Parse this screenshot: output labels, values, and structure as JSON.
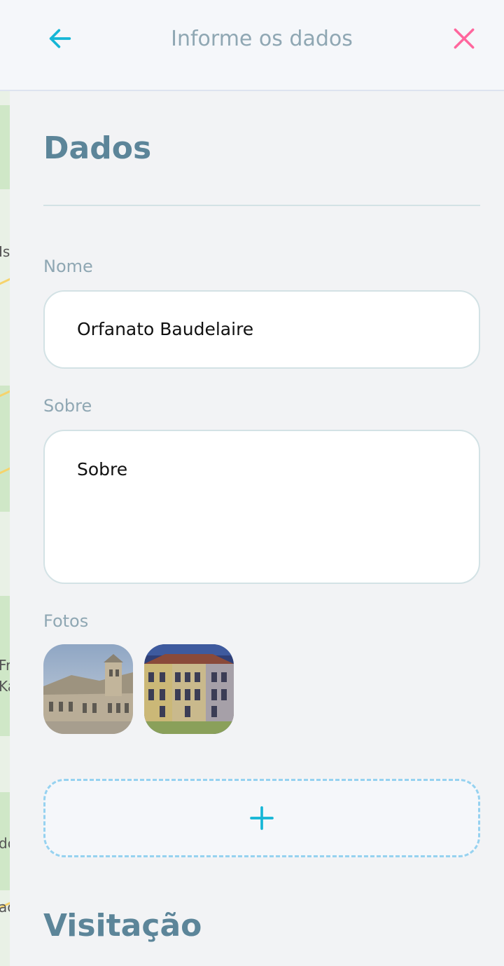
{
  "header": {
    "title": "Informe os dados",
    "back_icon": "arrow-left-icon",
    "close_icon": "close-icon",
    "accent_color": "#15b6d6",
    "close_color": "#ff669d"
  },
  "map_fragments": [
    "Is",
    "Fr",
    "Ka",
    "do",
    "ac"
  ],
  "form": {
    "section_title": "Dados",
    "name_label": "Nome",
    "name_value": "Orfanato Baudelaire",
    "about_label": "Sobre",
    "about_value": "Sobre",
    "photos_label": "Fotos",
    "photos": [
      {
        "icon": "building-photo-1"
      },
      {
        "icon": "building-photo-2"
      }
    ],
    "add_photo_icon": "plus-icon"
  },
  "visit": {
    "section_title": "Visitação"
  }
}
